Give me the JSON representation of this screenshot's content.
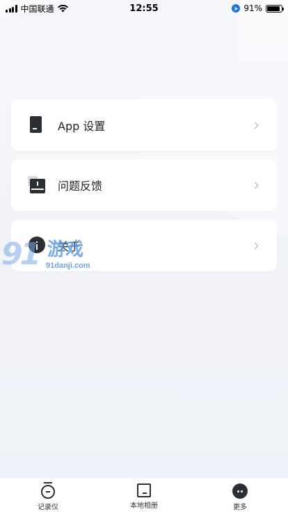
{
  "status_bar": {
    "carrier": "中国联通",
    "time": "12:55",
    "battery_pct": "91%",
    "battery_level": 0.91
  },
  "menu": {
    "items": [
      {
        "label": "App 设置",
        "icon": "app-settings-icon"
      },
      {
        "label": "问题反馈",
        "icon": "feedback-icon"
      },
      {
        "label": "关于",
        "icon": "info-icon"
      }
    ]
  },
  "watermark": {
    "number": "91",
    "text": "游戏",
    "url": "91danji.com"
  },
  "tabbar": {
    "tabs": [
      {
        "label": "记录仪",
        "icon": "recorder-icon"
      },
      {
        "label": "本地相册",
        "icon": "album-icon"
      },
      {
        "label": "更多",
        "icon": "more-icon",
        "active": true
      }
    ]
  },
  "colors": {
    "background": "#f1f3f8",
    "card": "#ffffff",
    "icon_dark": "#2b2e33",
    "watermark_blue": "#5a96e1"
  }
}
